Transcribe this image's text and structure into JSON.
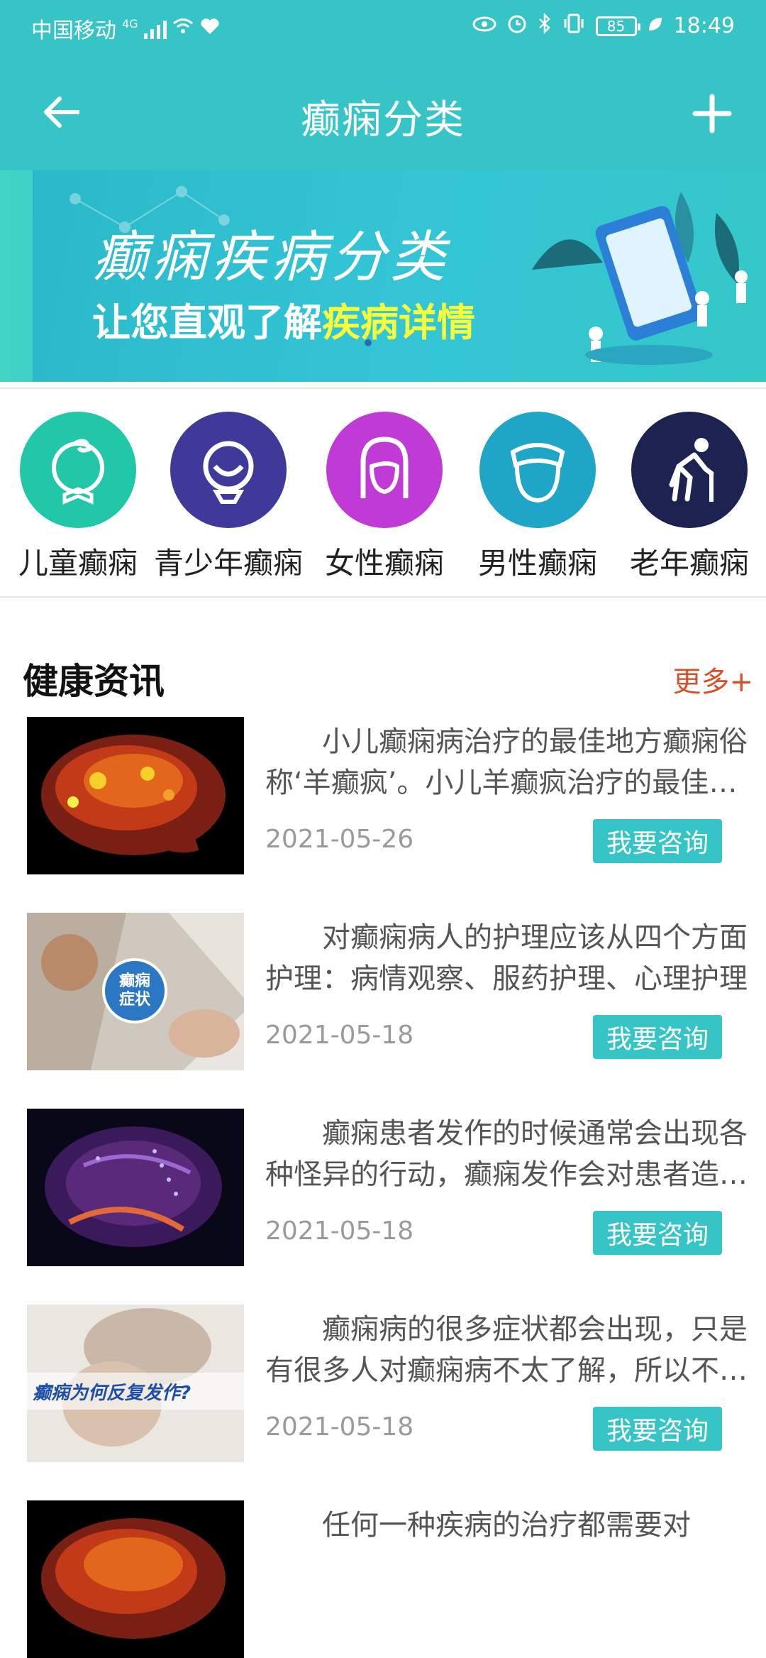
{
  "status_bar": {
    "carrier": "中国移动",
    "network": "4G",
    "battery": "85",
    "time": "18:49"
  },
  "title_bar": {
    "title": "癫痫分类",
    "back_icon": "back-arrow-icon",
    "add_icon": "plus-icon"
  },
  "banner": {
    "line1": "癫痫疾病分类",
    "line2_prefix": "让您直观了解",
    "line2_highlight": "疾病详情"
  },
  "categories": [
    {
      "label": "儿童癫痫",
      "color": "#22c7a8",
      "icon": "child-icon"
    },
    {
      "label": "青少年癫痫",
      "color": "#3f3a9a",
      "icon": "teen-icon"
    },
    {
      "label": "女性癫痫",
      "color": "#c03ad6",
      "icon": "woman-icon"
    },
    {
      "label": "男性癫痫",
      "color": "#1fa6c7",
      "icon": "man-icon"
    },
    {
      "label": "老年癫痫",
      "color": "#1d2250",
      "icon": "elderly-icon"
    }
  ],
  "news": {
    "title": "健康资讯",
    "more": "更多+",
    "consult_label": "我要咨询",
    "items": [
      {
        "text": "小儿癫痫病治疗的最佳地方癫痫俗称‘羊癫疯’。小儿羊癫疯治疗的最佳地方",
        "date": "2021-05-26",
        "thumb": "brain-heatmap-image"
      },
      {
        "text": "对癫痫病人的护理应该从四个方面护理：病情观察、服药护理、心理护理",
        "date": "2021-05-18",
        "thumb": "children-symptoms-image"
      },
      {
        "text": "癫痫患者发作的时候通常会出现各种怪异的行动，癫痫发作会对患者造成伤害",
        "date": "2021-05-18",
        "thumb": "brain-scan-image"
      },
      {
        "text": "癫痫病的很多症状都会出现，只是有很多人对癫痫病不太了解，所以不知道",
        "date": "2021-05-18",
        "thumb": "recurrent-seizure-image"
      },
      {
        "text": "任何一种疾病的治疗都需要对",
        "date": "",
        "thumb": "brain-heatmap-image"
      }
    ],
    "thumb5_caption": "癫痫为何反复发作?",
    "thumb2_badge": "癫痫症状"
  }
}
